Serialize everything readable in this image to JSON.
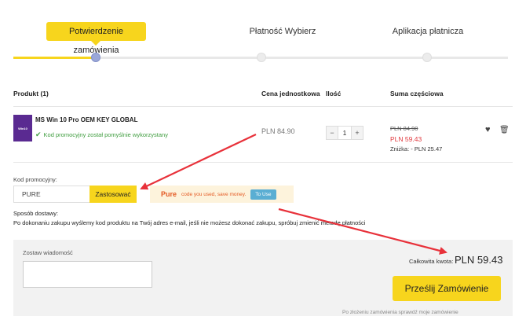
{
  "steps": [
    {
      "label": "Potwierdzenie zamówienia",
      "active": true
    },
    {
      "label": "Płatność Wybierz",
      "active": false
    },
    {
      "label": "Aplikacja płatnicza",
      "active": false
    }
  ],
  "table": {
    "headers": {
      "product": "Produkt (1)",
      "unit_price": "Cena jednostkowa",
      "quantity": "Ilość",
      "subtotal": "Suma częściowa"
    }
  },
  "product": {
    "image_text": "Win10",
    "name": "MS Win 10 Pro OEM KEY GLOBAL",
    "promo_status": "Kod promocyjny został pomyślnie wykorzystany",
    "unit_price": "PLN 84.90",
    "quantity": "1",
    "minus": "−",
    "plus": "+",
    "old_price": "PLN 84.90",
    "new_price": "PLN 59.43",
    "discount": "Zniżka: - PLN 25.47"
  },
  "promo": {
    "label": "Kod promocyjny:",
    "code_value": "PURE",
    "apply_label": "Zastosować",
    "banner_code": "Pure",
    "banner_text": "code you used, save money.",
    "banner_button": "To Use"
  },
  "shipping": {
    "label": "Sposób dostawy:",
    "text": "Po dokonaniu zakupu wyślemy kod produktu na Twój adres e-mail, jeśli nie możesz dokonać zakupu, spróbuj zmienić metodę płatności"
  },
  "message": {
    "label": "Zostaw wiadomość"
  },
  "summary": {
    "total_label": "Całkowita kwota:",
    "total_value": "PLN 59.43",
    "submit_label": "Prześlij Zamówienie",
    "footnote": "Po złożeniu zamówienia sprawdź moje zamówienie"
  },
  "colors": {
    "accent": "#f7d51d",
    "price_red": "#e0393e",
    "success_green": "#3f9d3f",
    "annotation_arrow": "#e8313a"
  },
  "icons": [
    "check-icon",
    "heart-icon",
    "trash-icon"
  ]
}
